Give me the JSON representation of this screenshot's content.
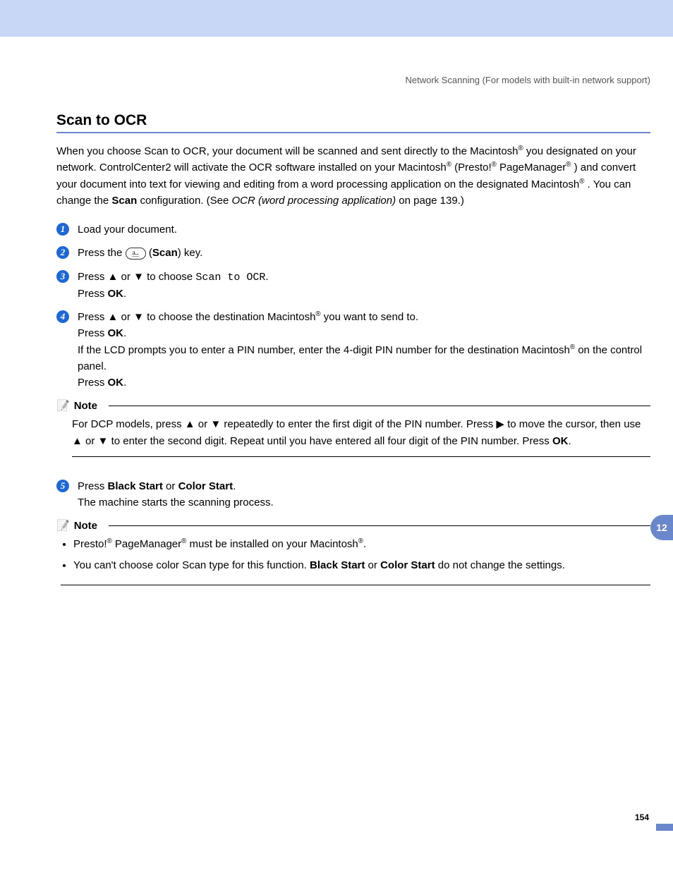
{
  "header": {
    "breadcrumb": "Network Scanning (For models with built-in network support)"
  },
  "title": "Scan to OCR",
  "intro": {
    "p1a": "When you choose Scan to OCR, your document will be scanned and sent directly to the Macintosh",
    "p1b": " you designated on your network. ControlCenter2 will activate the OCR software installed on your Macintosh",
    "p1c": " (Presto!",
    "p1d": " PageManager",
    "p1e": ") and convert your document into text for viewing and editing from a word processing application on the designated Macintosh",
    "p1f": ". You can change the ",
    "scan_bold": "Scan",
    "p1g": " configuration. (See ",
    "link_italic": "OCR (word processing application)",
    "p1h": " on page 139.)"
  },
  "steps": {
    "s1": "Load your document.",
    "s2a": "Press the ",
    "s2b": " (",
    "s2bold": "Scan",
    "s2c": ") key.",
    "s3a": "Press ",
    "up": "▲",
    "or": " or ",
    "down": "▼",
    "s3b": " to choose ",
    "s3mono": "Scan to OCR",
    "s3c": ".",
    "press_ok_pre": "Press ",
    "ok": "OK",
    "dot": ".",
    "s4a": " to choose the destination Macintosh",
    "s4b": " you want to send to.",
    "s4c": "If the LCD prompts you to enter a PIN number, enter the 4-digit PIN number for the destination Macintosh",
    "s4d": " on the control panel.",
    "s5a": "Press ",
    "s5b1": "Black Start",
    "s5or": " or ",
    "s5b2": "Color Start",
    "s5c": "The machine starts the scanning process."
  },
  "note1": {
    "label": "Note",
    "a": "For DCP models, press ",
    "b": " repeatedly to enter the first digit of the PIN number. Press ",
    "right": "▶",
    "c": " to move the cursor, then use ",
    "d": " to enter the second digit. Repeat until you have entered all four digit of the PIN number. Press ",
    "ok": "OK",
    "e": "."
  },
  "note2": {
    "label": "Note",
    "li1a": "Presto!",
    "li1b": " PageManager",
    "li1c": " must be installed on your Macintosh",
    "li1d": ".",
    "li2a": "You can't choose color Scan type for this function. ",
    "li2b1": "Black Start",
    "li2or": " or ",
    "li2b2": "Color Start",
    "li2c": " do not change the settings."
  },
  "sidebar": {
    "chapter": "12"
  },
  "footer": {
    "page": "154"
  }
}
